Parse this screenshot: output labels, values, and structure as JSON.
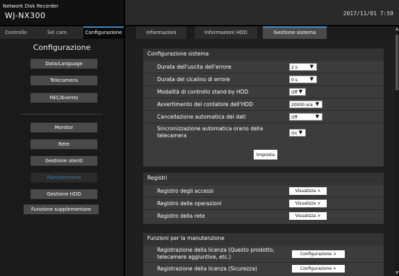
{
  "header": {
    "product_line": "Network Disk Recorder",
    "model": "WJ-NX300",
    "datetime": "2017/11/01  7:59"
  },
  "left_tabs": [
    {
      "label": "Controllo"
    },
    {
      "label": "Sel cam."
    },
    {
      "label": "Configurazione"
    }
  ],
  "left_menu": {
    "title": "Configurazione",
    "items": [
      {
        "label": "Data/Language"
      },
      {
        "label": "Telecamera"
      },
      {
        "label": "REC/Evento"
      },
      {
        "label": "Monitor"
      },
      {
        "label": "Rete"
      },
      {
        "label": "Gestione utenti"
      },
      {
        "label": "Manutenzione"
      },
      {
        "label": "Gestione HDD"
      },
      {
        "label": "Funzione supplementare"
      }
    ]
  },
  "right_tabs": [
    {
      "label": "Informazioni sistema"
    },
    {
      "label": "Informazioni HDD"
    },
    {
      "label": "Gestione sistema"
    }
  ],
  "config_section": {
    "title": "Configurazione sistema",
    "rows": [
      {
        "label": "Durata dell'uscita dell'errore",
        "value": "2 s"
      },
      {
        "label": "Durata del cicalino di errore",
        "value": "0 s"
      },
      {
        "label": "Modalità di controllo stand-by HDD",
        "value": "Off"
      },
      {
        "label": "Avvertimento del contatore dell'HDD",
        "value": "20000 ora"
      },
      {
        "label": "Cancellazione automatica dei dati",
        "value": "Off"
      },
      {
        "label": "Sincronizzazione automatica orario della telecamera",
        "value": "On"
      }
    ],
    "apply_label": "Imposta"
  },
  "logs_section": {
    "title": "Registri",
    "rows": [
      {
        "label": "Registro degli accessi",
        "button": "Visualizza >"
      },
      {
        "label": "Registro delle operazioni",
        "button": "Visualizza >"
      },
      {
        "label": "Registro della rete",
        "button": "Visualizza >"
      }
    ]
  },
  "maint_section": {
    "title": "Funzioni per la manutenzione",
    "rows": [
      {
        "label": "Registrazione della licenza (Questo prodotto, telecamere aggiuntive, etc.)",
        "button": "Configurazione >"
      },
      {
        "label": "Registrazione della licenza (Sicurezza)",
        "button": "Configurazione >"
      }
    ]
  },
  "colors": {
    "accent": "#3a8fd0",
    "active_menu_text": "#3a7bb8"
  }
}
